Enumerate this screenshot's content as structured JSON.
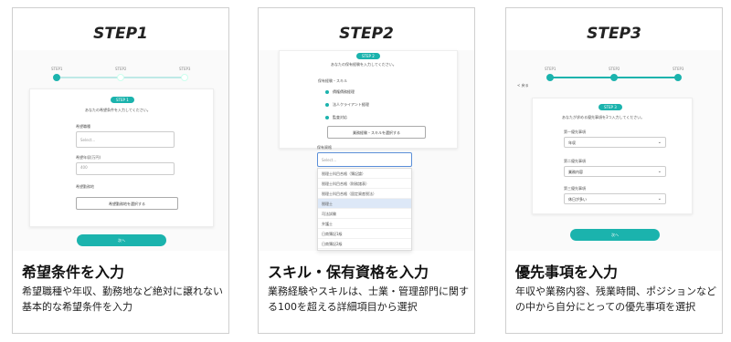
{
  "cards": [
    {
      "step": "STEP1",
      "heading": "希望条件を入力",
      "desc": "希望職種や年収、勤務地など絶対に譲れない基本的な希望条件を入力",
      "shot": {
        "progress": [
          "STEP1",
          "STEP2",
          "STEP3"
        ],
        "badge": "STEP 1",
        "intro": "あなたの希望条件を入力してください。",
        "job_label": "希望職種",
        "job_placeholder": "Select...",
        "salary_label": "希望年収(万円)",
        "salary_placeholder": "400",
        "location_label": "希望勤務地",
        "location_button": "希望勤務地を選択する",
        "next": "次へ"
      }
    },
    {
      "step": "STEP2",
      "heading": "スキル・保有資格を入力",
      "desc": "業務経験やスキルは、士業・管理部門に関する100を超える詳細項目から選択",
      "shot": {
        "badge": "STEP 2",
        "intro": "あなたの保有経験を入力してください。",
        "skills_label": "保有経験・スキル",
        "skills": [
          "債権債務経理",
          "法人クライアント経理",
          "監査対応"
        ],
        "skills_button": "業務経験・スキルを選択する",
        "cert_label": "保有資格",
        "cert_placeholder": "Select...",
        "options": [
          "税理士科目合格（簿記論）",
          "税理士科目合格（財務諸表）",
          "税理士科目合格（固定資産税法）",
          "税理士",
          "司法試験",
          "弁護士",
          "日商簿記1級",
          "日商簿記2級"
        ]
      }
    },
    {
      "step": "STEP3",
      "heading": "優先事項を入力",
      "desc": "年収や業務内容、残業時間、ポジションなどの中から自分にとっての優先事項を選択",
      "shot": {
        "progress": [
          "STEP1",
          "STEP2",
          "STEP3"
        ],
        "back": "< 戻る",
        "badge": "STEP 3",
        "intro": "あなたが求める優先事項を3つ入力してください。",
        "p1_label": "第一優先事項",
        "p1_value": "年収",
        "p2_label": "第二優先事項",
        "p2_value": "業務内容",
        "p3_label": "第三優先事項",
        "p3_value": "休日が多い",
        "next": "次へ"
      }
    }
  ]
}
